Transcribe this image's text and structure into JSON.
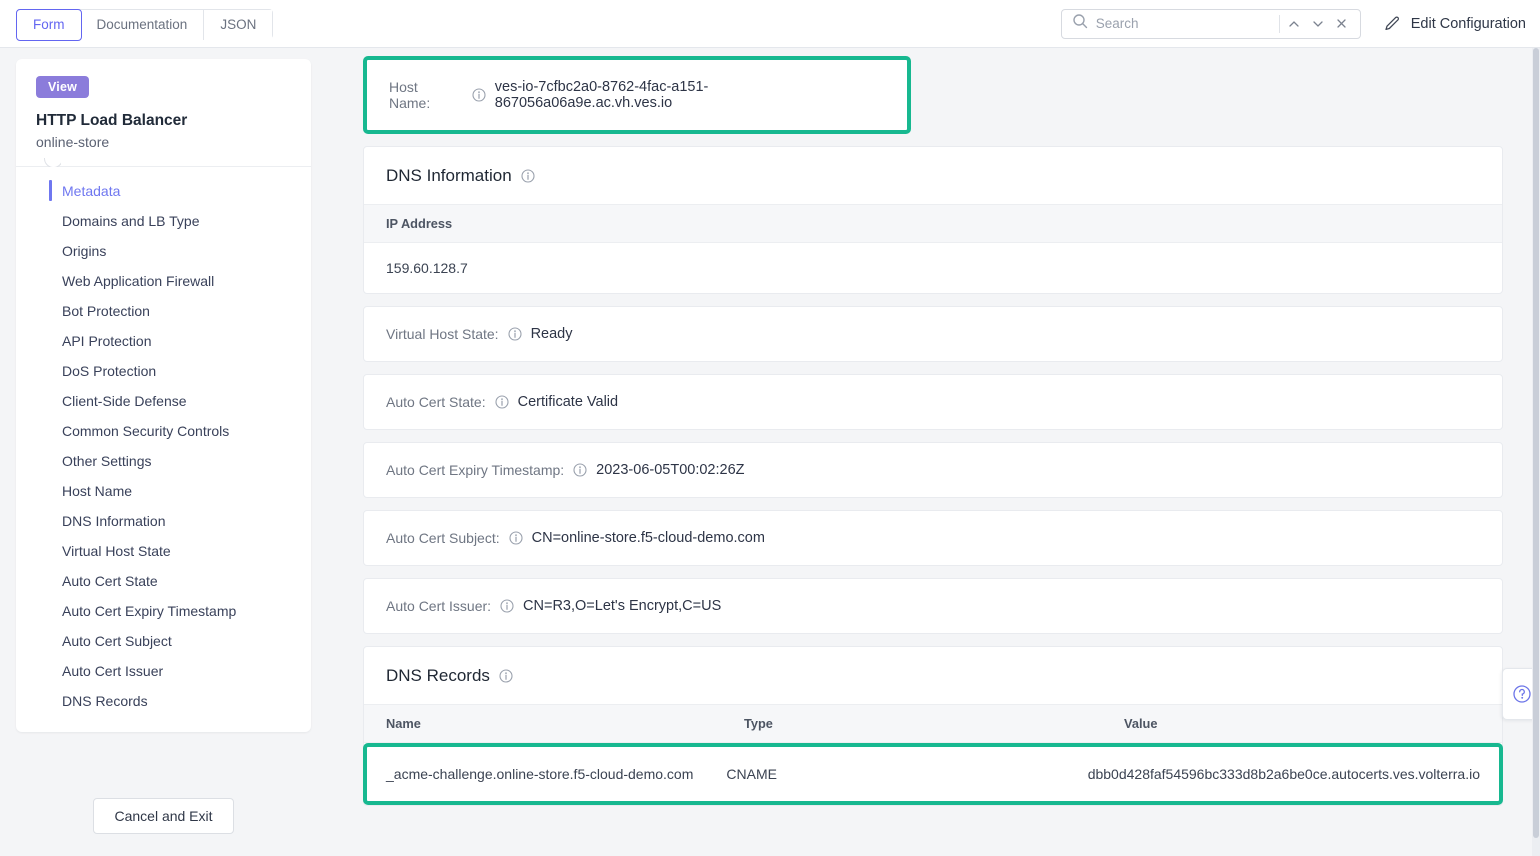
{
  "topbar": {
    "tabs": [
      {
        "label": "Form",
        "active": true
      },
      {
        "label": "Documentation",
        "active": false
      },
      {
        "label": "JSON",
        "active": false
      }
    ],
    "search": {
      "placeholder": "Search",
      "value": ""
    },
    "edit_configuration_label": "Edit Configuration",
    "icons": {
      "search": "search-icon",
      "prev": "chevron-up-icon",
      "next": "chevron-down-icon",
      "clear": "close-icon",
      "edit": "pencil-icon"
    }
  },
  "sidebar": {
    "badge": "View",
    "title": "HTTP Load Balancer",
    "subtitle": "online-store",
    "items": [
      {
        "label": "Metadata",
        "active": true
      },
      {
        "label": "Domains and LB Type",
        "active": false
      },
      {
        "label": "Origins",
        "active": false
      },
      {
        "label": "Web Application Firewall",
        "active": false
      },
      {
        "label": "Bot Protection",
        "active": false
      },
      {
        "label": "API Protection",
        "active": false
      },
      {
        "label": "DoS Protection",
        "active": false
      },
      {
        "label": "Client-Side Defense",
        "active": false
      },
      {
        "label": "Common Security Controls",
        "active": false
      },
      {
        "label": "Other Settings",
        "active": false
      },
      {
        "label": "Host Name",
        "active": false
      },
      {
        "label": "DNS Information",
        "active": false
      },
      {
        "label": "Virtual Host State",
        "active": false
      },
      {
        "label": "Auto Cert State",
        "active": false
      },
      {
        "label": "Auto Cert Expiry Timestamp",
        "active": false
      },
      {
        "label": "Auto Cert Subject",
        "active": false
      },
      {
        "label": "Auto Cert Issuer",
        "active": false
      },
      {
        "label": "DNS Records",
        "active": false
      }
    ],
    "cancel_label": "Cancel and Exit"
  },
  "main": {
    "host_name": {
      "label": "Host Name:",
      "value": "ves-io-7cfbc2a0-8762-4fac-a151-867056a06a9e.ac.vh.ves.io",
      "highlight_color": "#17b890"
    },
    "dns_information": {
      "title": "DNS Information",
      "column": "IP Address",
      "rows": [
        "159.60.128.7"
      ]
    },
    "fields": [
      {
        "label": "Virtual Host State:",
        "value": "Ready"
      },
      {
        "label": "Auto Cert State:",
        "value": "Certificate Valid"
      },
      {
        "label": "Auto Cert Expiry Timestamp:",
        "value": "2023-06-05T00:02:26Z"
      },
      {
        "label": "Auto Cert Subject:",
        "value": "CN=online-store.f5-cloud-demo.com"
      },
      {
        "label": "Auto Cert Issuer:",
        "value": "CN=R3,O=Let's Encrypt,C=US"
      }
    ],
    "dns_records": {
      "title": "DNS Records",
      "columns": [
        "Name",
        "Type",
        "Value"
      ],
      "rows": [
        {
          "name": "_acme-challenge.online-store.f5-cloud-demo.com",
          "type": "CNAME",
          "value": "dbb0d428faf54596bc333d8b2a6be0ce.autocerts.ves.volterra.io",
          "highlighted": true
        }
      ],
      "highlight_color": "#17b890"
    }
  },
  "help": {
    "icon": "question-mark-icon"
  },
  "colors": {
    "accent_indigo": "#6366f1",
    "badge_purple": "#8b7cdb",
    "highlight_green": "#17b890",
    "page_bg": "#f4f5f7"
  }
}
